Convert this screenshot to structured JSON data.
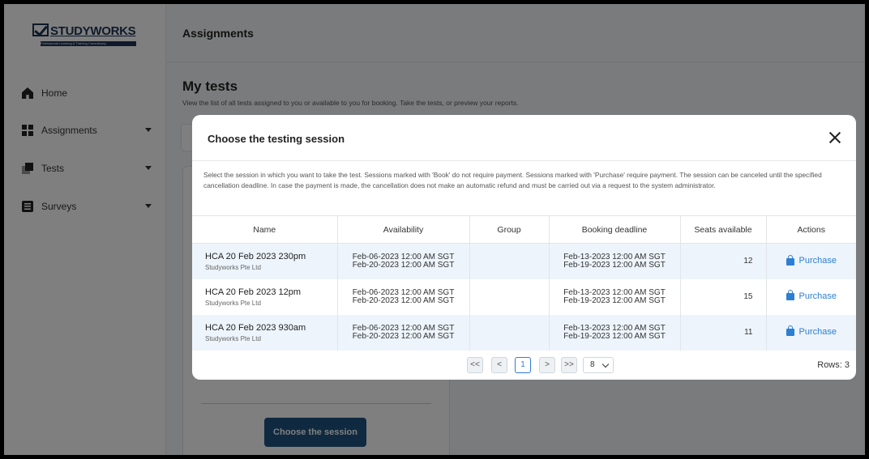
{
  "sidebar": {
    "logo_text": "STUDYWORKS",
    "logo_tagline": "Professional Learning & Training Consultancy",
    "items": [
      {
        "label": "Home",
        "icon": "home-icon"
      },
      {
        "label": "Assignments",
        "icon": "grid-icon"
      },
      {
        "label": "Tests",
        "icon": "stack-icon"
      },
      {
        "label": "Surveys",
        "icon": "list-icon"
      }
    ]
  },
  "header": {
    "title": "Assignments"
  },
  "main": {
    "title": "My tests",
    "description": "View the list of all tests assigned to you or available to you for booking. Take the tests, or preview your reports.",
    "choose_button": "Choose the session"
  },
  "modal": {
    "title": "Choose the testing session",
    "description": "Select the session in which you want to take the test. Sessions marked with 'Book' do not require payment. Sessions marked with 'Purchase' require payment. The session can be canceled until the specified cancellation deadline. In case the payment is made, the cancellation does not make an automatic refund and must be carried out via a request to the system administrator.",
    "columns": [
      "Name",
      "Availability",
      "Group",
      "Booking deadline",
      "Seats available",
      "Actions"
    ],
    "rows": [
      {
        "name": "HCA 20 Feb 2023 230pm",
        "org": "Studyworks Pte Ltd",
        "avail_from": "Feb-06-2023 12:00 AM SGT",
        "avail_to": "Feb-20-2023 12:00 AM SGT",
        "group": "",
        "deadline_1": "Feb-13-2023 12:00 AM SGT",
        "deadline_2": "Feb-19-2023 12:00 AM SGT",
        "seats": "12",
        "action": "Purchase"
      },
      {
        "name": "HCA 20 Feb 2023 12pm",
        "org": "Studyworks Pte Ltd",
        "avail_from": "Feb-06-2023 12:00 AM SGT",
        "avail_to": "Feb-20-2023 12:00 AM SGT",
        "group": "",
        "deadline_1": "Feb-13-2023 12:00 AM SGT",
        "deadline_2": "Feb-19-2023 12:00 AM SGT",
        "seats": "15",
        "action": "Purchase"
      },
      {
        "name": "HCA 20 Feb 2023 930am",
        "org": "Studyworks Pte Ltd",
        "avail_from": "Feb-06-2023 12:00 AM SGT",
        "avail_to": "Feb-20-2023 12:00 AM SGT",
        "group": "",
        "deadline_1": "Feb-13-2023 12:00 AM SGT",
        "deadline_2": "Feb-19-2023 12:00 AM SGT",
        "seats": "11",
        "action": "Purchase"
      }
    ],
    "pagination": {
      "first": "<<",
      "prev": "<",
      "current": "1",
      "next": ">",
      "last": ">>",
      "page_size": "8",
      "rows_label": "Rows: 3"
    }
  }
}
